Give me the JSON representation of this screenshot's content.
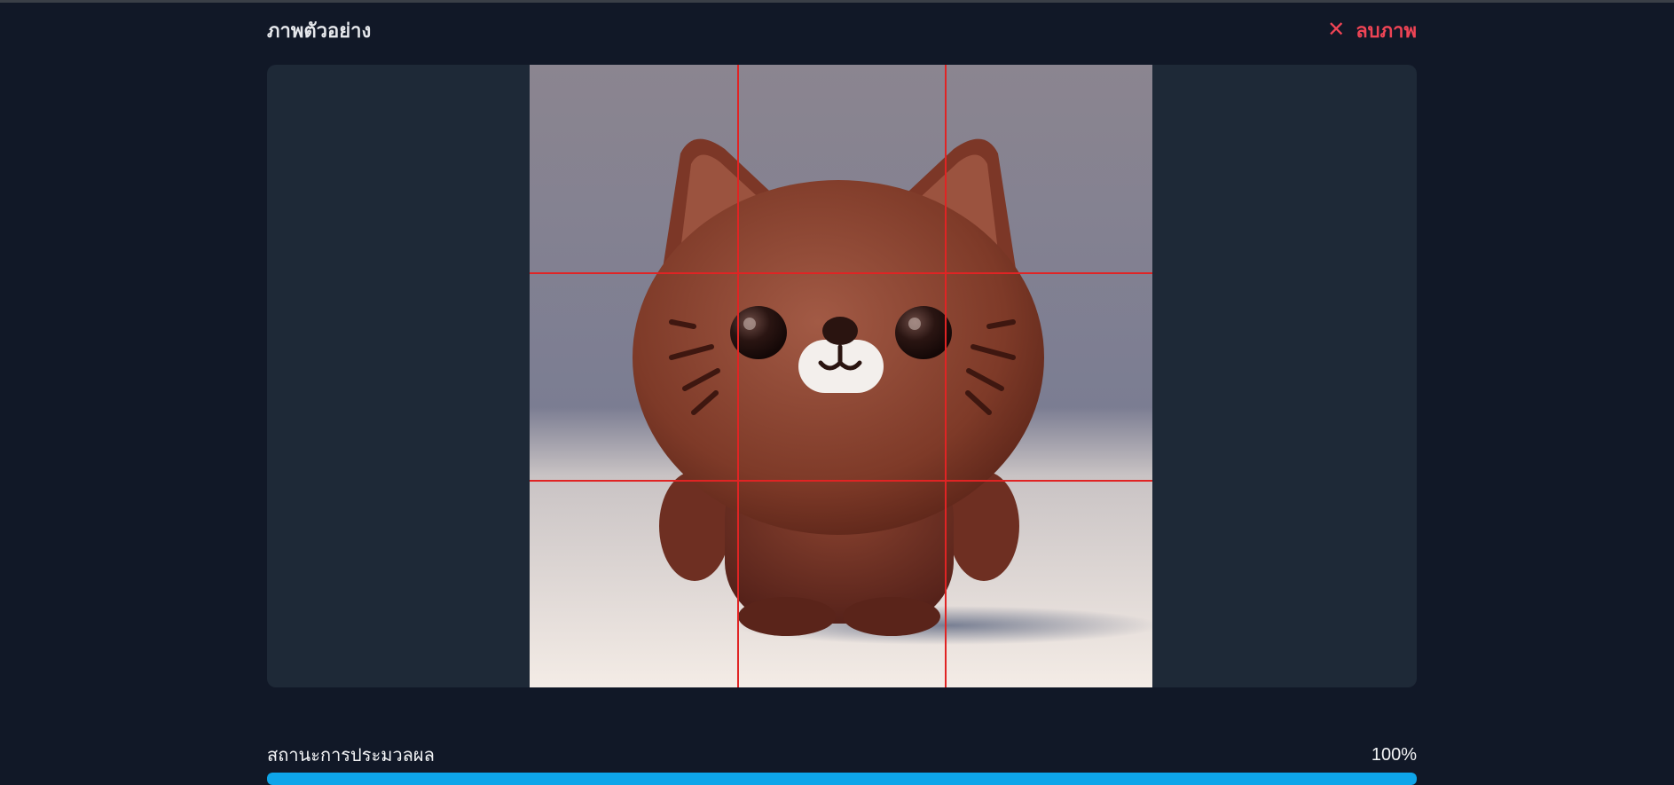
{
  "header": {
    "title": "ภาพตัวอย่าง",
    "remove_label": "ลบภาพ"
  },
  "preview": {
    "image_alt": "ภาพตัวอย่าง",
    "grid": "3x3",
    "grid_color": "#e02424"
  },
  "status": {
    "label": "สถานะการประมวลผล",
    "percent_text": "100%",
    "progress": 1.0,
    "bar_color": "#0ea5e9"
  },
  "colors": {
    "background": "#111827",
    "panel": "#1e2937",
    "danger": "#ef4455"
  }
}
